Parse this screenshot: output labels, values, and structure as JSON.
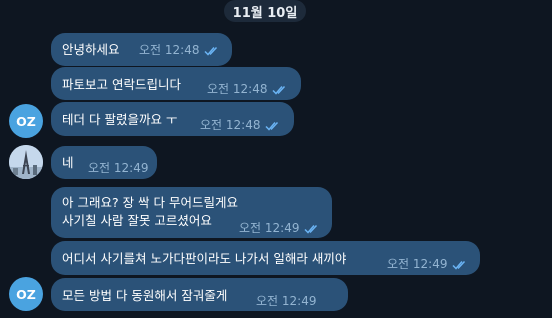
{
  "date_label": "11월 10일",
  "avatars": {
    "oz_initials": "OZ",
    "profile_photo": "eiffel-tower-photo"
  },
  "messages": [
    {
      "text": "안녕하세요",
      "time": "오전 12:48",
      "read": true
    },
    {
      "text": "파토보고 연락드립니다",
      "time": "오전 12:48",
      "read": true
    },
    {
      "text": "테더 다 팔렸을까요 ㅜ",
      "time": "오전 12:48",
      "read": true
    },
    {
      "text": "네",
      "time": "오전 12:49",
      "read": false
    },
    {
      "line1": "아 그래요? 장 싹 다 무어드릴게요",
      "line2": "사기칠 사람 잘못 고르셨어요",
      "time": "오전 12:49",
      "read": true
    },
    {
      "text": "어디서 사기를쳐 노가다판이라도 나가서 일해라 새끼야",
      "time": "오전 12:49",
      "read": true
    },
    {
      "text": "모든 방법 다 동원해서 잠궈줄게",
      "time": "오전 12:49",
      "read": false
    }
  ],
  "colors": {
    "background": "#0e1621",
    "outgoing_bubble": "#2b5278",
    "incoming_bubble": "#182533",
    "meta_text": "#93b4d1",
    "avatar_oz": "#4aa3e0"
  }
}
